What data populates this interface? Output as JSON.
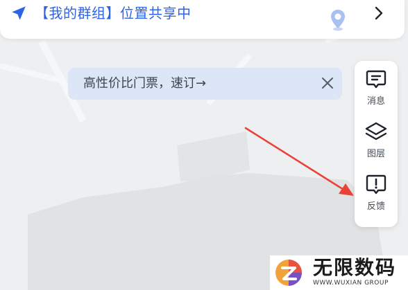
{
  "banner": {
    "text": "【我的群组】位置共享中"
  },
  "promo": {
    "text": "高性价比门票，速订→"
  },
  "toolbar": {
    "items": [
      {
        "label": "消息",
        "icon": "message-icon"
      },
      {
        "label": "图层",
        "icon": "layers-icon"
      },
      {
        "label": "反馈",
        "icon": "feedback-icon"
      }
    ]
  },
  "watermark": {
    "title": "无限数码",
    "subtitle": "WWW.WUXIAN GROUP"
  },
  "colors": {
    "accent": "#2e63e6",
    "promo_bg": "#dde6f6",
    "arrow": "#e8423b",
    "map_bg": "#eeeff1"
  }
}
